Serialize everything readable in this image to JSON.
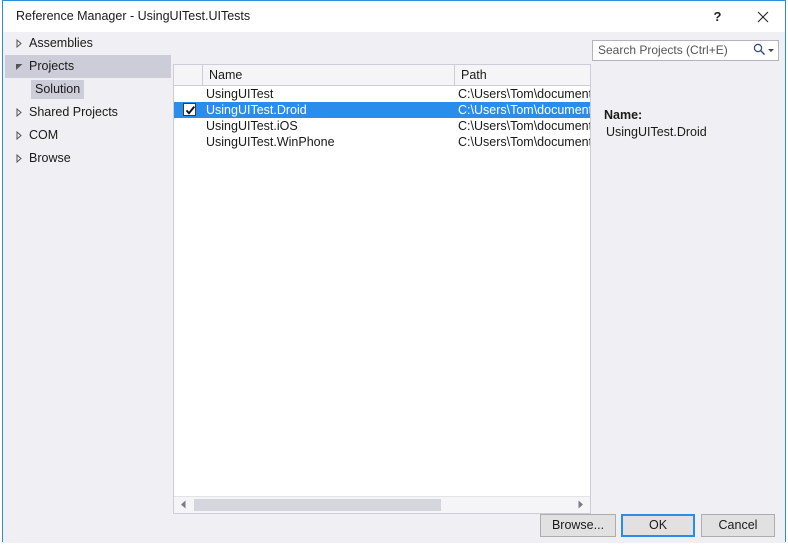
{
  "window": {
    "title": "Reference Manager - UsingUITest.UITests",
    "help_label": "?",
    "close_label": "Close",
    "accent_color": "#2e8dda"
  },
  "search": {
    "placeholder": "Search Projects (Ctrl+E)",
    "value": "",
    "icon": "search-icon",
    "dropdown_icon": "chevron-down-icon"
  },
  "sidebar": {
    "items": [
      {
        "label": "Assemblies",
        "expanded": false,
        "selected": false,
        "arrow": "chevron-right-icon"
      },
      {
        "label": "Projects",
        "expanded": true,
        "selected": true,
        "arrow": "chevron-down-icon"
      },
      {
        "label": "Shared Projects",
        "expanded": false,
        "selected": false,
        "arrow": "chevron-right-icon"
      },
      {
        "label": "COM",
        "expanded": false,
        "selected": false,
        "arrow": "chevron-right-icon"
      },
      {
        "label": "Browse",
        "expanded": false,
        "selected": false,
        "arrow": "chevron-right-icon"
      }
    ],
    "child": {
      "label": "Solution",
      "selected": true
    }
  },
  "list": {
    "columns": [
      {
        "key": "check",
        "label": ""
      },
      {
        "key": "name",
        "label": "Name"
      },
      {
        "key": "path",
        "label": "Path"
      }
    ],
    "rows": [
      {
        "checked": false,
        "name": "UsingUITest",
        "path": "C:\\Users\\Tom\\document",
        "selected": false
      },
      {
        "checked": true,
        "name": "UsingUITest.Droid",
        "path": "C:\\Users\\Tom\\document",
        "selected": true
      },
      {
        "checked": false,
        "name": "UsingUITest.iOS",
        "path": "C:\\Users\\Tom\\document",
        "selected": false
      },
      {
        "checked": false,
        "name": "UsingUITest.WinPhone",
        "path": "C:\\Users\\Tom\\document",
        "selected": false
      }
    ],
    "selection_color": "#2a8dec",
    "scrollbar": {
      "thumb_percent": 65,
      "left_icon": "triangle-left-icon",
      "right_icon": "triangle-right-icon"
    }
  },
  "detail": {
    "name_label": "Name:",
    "name_value": "UsingUITest.Droid"
  },
  "footer": {
    "browse_label": "Browse...",
    "ok_label": "OK",
    "cancel_label": "Cancel",
    "default_button": "OK"
  }
}
